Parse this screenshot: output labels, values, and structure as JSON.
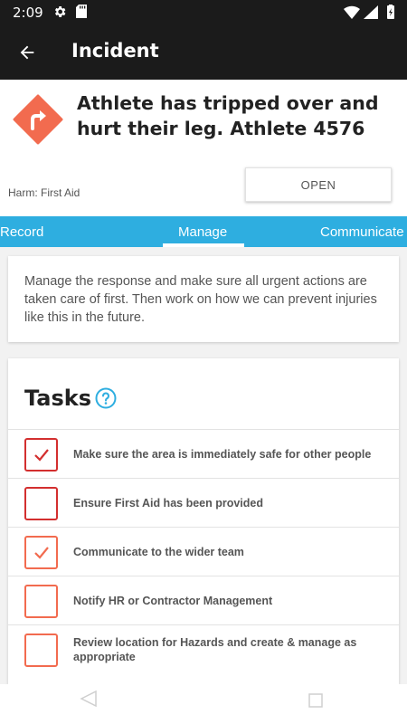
{
  "status_bar": {
    "time": "2:09",
    "icons": [
      "gear-icon",
      "sd-card-icon",
      "wifi-icon",
      "signal-icon",
      "battery-icon"
    ]
  },
  "app_bar": {
    "title": "Incident",
    "back_icon": "arrow-back-icon"
  },
  "incident": {
    "icon": "hazard-diamond-icon",
    "title": "Athlete has tripped over and hurt their leg. Athlete 4576",
    "harm": "Harm: First Aid",
    "status": "OPEN"
  },
  "tabs": [
    {
      "label": "Record",
      "selected": false
    },
    {
      "label": "Manage",
      "selected": true
    },
    {
      "label": "Communicate",
      "selected": false
    }
  ],
  "intro": {
    "text": "Manage the response and make sure all urgent actions are taken care of first. Then work on how we can prevent injuries like this in the future."
  },
  "tasks": {
    "title": "Tasks",
    "help_icon": "help-circle-icon",
    "items": [
      {
        "label": "Make sure the area is immediately safe for other people",
        "checked": true,
        "color": "#d32f2f"
      },
      {
        "label": "Ensure First Aid has been provided",
        "checked": false,
        "color": "#d32f2f"
      },
      {
        "label": "Communicate to the wider team",
        "checked": true,
        "color": "#f26b4f"
      },
      {
        "label": "Notify HR or Contractor Management",
        "checked": false,
        "color": "#f26b4f"
      },
      {
        "label": "Review location for Hazards and create & manage as appropriate",
        "checked": false,
        "color": "#f26b4f"
      }
    ]
  },
  "colors": {
    "app_bar": "#1b1b1b",
    "tab_bar": "#2eaee0",
    "hazard": "#f26b4f",
    "help": "#2eaee0"
  }
}
